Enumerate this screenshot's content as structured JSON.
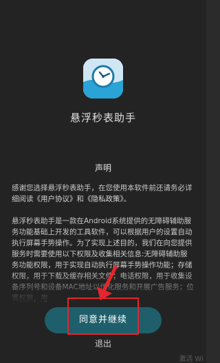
{
  "app": {
    "name": "悬浮秒表助手",
    "icon": "stopwatch-icon"
  },
  "statement": {
    "title": "声明",
    "p1_before": "感谢您选择悬浮秒表助手，在您使用本软件前还请务必详细阅读",
    "p1_link1": "《用户协议》",
    "p1_mid": "和",
    "p1_link2": "《隐私政策》",
    "p1_after": "。",
    "p2": "悬浮秒表助手是一款在Android系统提供的无障碍辅助服务功能基础上开发的工具软件，可以根据用户的设置自动执行屏幕手势操作。为了实现上述目的，我们在向您提供服务时需要使用以下权限及收集相关信息:无障碍辅助服务功能权限，用于实现自动执行屏幕手势操作功能；存储权限，用于下载及缓存相关文件；电话权限，用于收集设备序列号和设备MAC地址以优化服务和开展广告服务；位置权限，用"
  },
  "buttons": {
    "agree": "同意并继续",
    "exit": "退出"
  },
  "watermark": "激活 Wi",
  "colors": {
    "background": "#232323",
    "button": "#1f5f6b",
    "highlight": "#e3262c"
  }
}
